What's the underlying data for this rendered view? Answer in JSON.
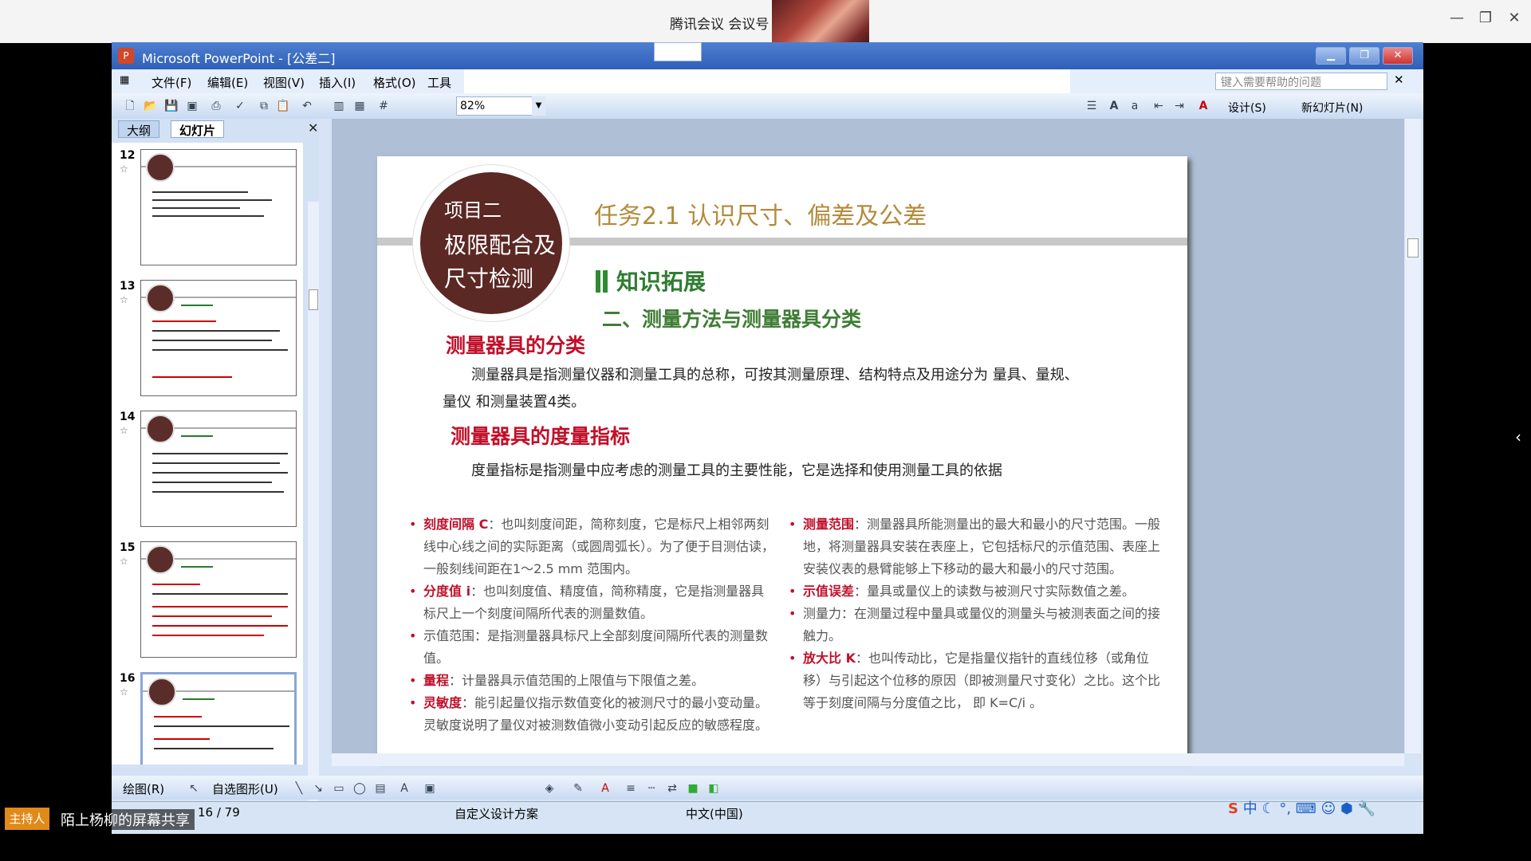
{
  "meeting": {
    "title": "腾讯会议 会议号",
    "min": "—",
    "restore": "❐",
    "close": "✕",
    "host_tag": "主持人",
    "share_label": "陌上杨柳的屏幕共享"
  },
  "ppt": {
    "title": "Microsoft PowerPoint - [公差二]",
    "menu": [
      "文件(F)",
      "编辑(E)",
      "视图(V)",
      "插入(I)",
      "格式(O)",
      "工具"
    ],
    "help_placeholder": "键入需要帮助的问题",
    "zoom": "82%",
    "design_label": "设计(S)",
    "new_slide_label": "新幻灯片(N)",
    "panel_tabs": [
      "大纲",
      "幻灯片"
    ],
    "thumbnails": [
      {
        "num": "12"
      },
      {
        "num": "13"
      },
      {
        "num": "14"
      },
      {
        "num": "15"
      },
      {
        "num": "16"
      }
    ],
    "draw_label": "绘图(R)",
    "autoshape_label": "自选图形(U)",
    "status": {
      "slide": "16 / 79",
      "design": "自定义设计方案",
      "lang": "中文(中国)"
    }
  },
  "slide": {
    "project_line1": "项目二",
    "project_line2": "极限配合及",
    "project_line3": "尺寸检测",
    "task_title": "任务2.1  认识尺寸、偏差及公差",
    "knowledge": "知识拓展",
    "section_title": "二、测量方法与测量器具分类",
    "head1": "测量器具的分类",
    "para1a": "测量器具是指测量仪器和测量工具的总称，可按其测量原理、结构特点及用途分为 量具、量规、",
    "para1b": "量仪 和测量装置4类。",
    "head2": "测量器具的度量指标",
    "para2": "度量指标是指测量中应考虑的测量工具的主要性能，它是选择和使用测量工具的依据",
    "left_items": [
      {
        "term": "刻度间隔 C",
        "text": "：也叫刻度间距，简称刻度，它是标尺上相邻两刻线中心线之间的实际距离（或圆周弧长）。为了便于目测估读，一般刻线间距在1～2.5 mm 范围内。"
      },
      {
        "term": "分度值 i",
        "text": "：也叫刻度值、精度值，简称精度，它是指测量器具标尺上一个刻度间隔所代表的测量数值。"
      },
      {
        "term": "",
        "text": "示值范围：是指测量器具标尺上全部刻度间隔所代表的测量数值。"
      },
      {
        "term": "量程",
        "text": "：计量器具示值范围的上限值与下限值之差。"
      },
      {
        "term": "灵敏度",
        "text": "：能引起量仪指示数值变化的被测尺寸的最小变动量。灵敏度说明了量仪对被测数值微小变动引起反应的敏感程度。"
      }
    ],
    "right_items": [
      {
        "term": "测量范围",
        "text": "：测量器具所能测量出的最大和最小的尺寸范围。一般地，将测量器具安装在表座上，它包括标尺的示值范围、表座上安装仪表的悬臂能够上下移动的最大和最小的尺寸范围。"
      },
      {
        "term": "示值误差",
        "text": "：量具或量仪上的读数与被测尺寸实际数值之差。"
      },
      {
        "term": "",
        "text": "测量力：在测量过程中量具或量仪的测量头与被测表面之间的接触力。"
      },
      {
        "term": "放大比 K",
        "text": "：也叫传动比，它是指量仪指针的直线位移（或角位移）与引起这个位移的原因（即被测量尺寸变化）之比。这个比等于刻度间隔与分度值之比， 即 K=C/i 。"
      }
    ]
  }
}
